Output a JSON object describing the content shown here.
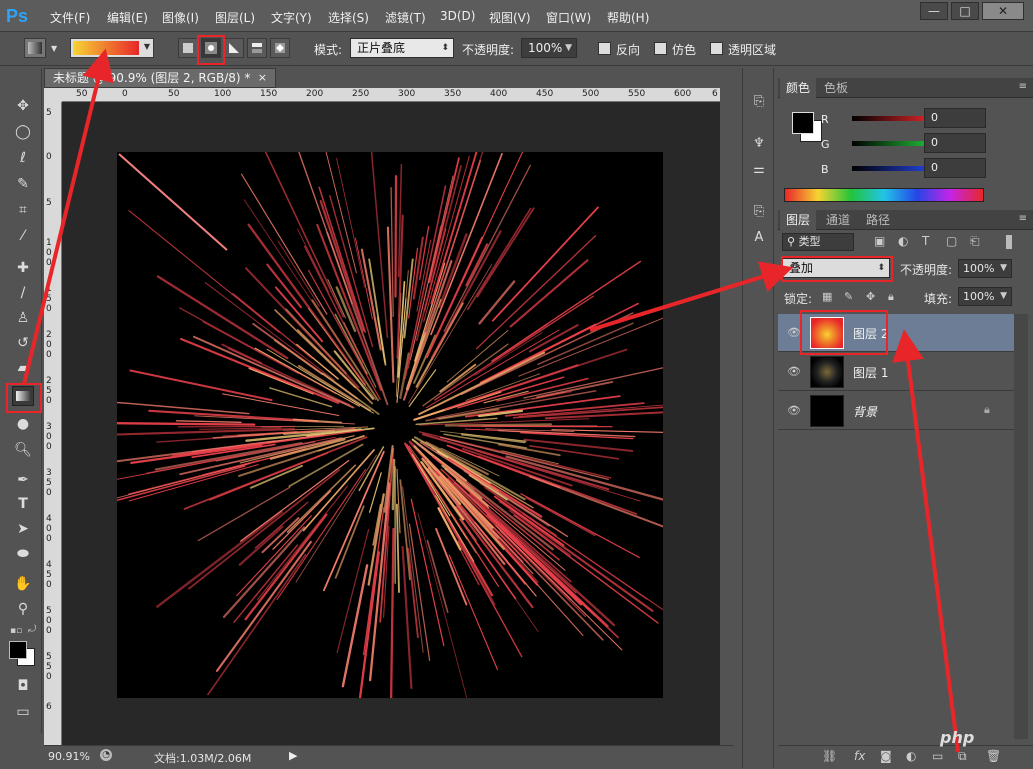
{
  "app": {
    "logo": "Ps",
    "menu": [
      "文件(F)",
      "编辑(E)",
      "图像(I)",
      "图层(L)",
      "文字(Y)",
      "选择(S)",
      "滤镜(T)",
      "3D(D)",
      "视图(V)",
      "窗口(W)",
      "帮助(H)"
    ],
    "window_buttons": {
      "minimize": "—",
      "maximize": "□",
      "close": "✕"
    }
  },
  "options": {
    "mode_label": "模式:",
    "mode_value": "正片叠底",
    "opacity_label": "不透明度:",
    "opacity_value": "100%",
    "reverse_label": "反向",
    "dither_label": "仿色",
    "transparency_label": "透明区域",
    "gradient_colors": [
      "#f7d433",
      "#e8262a"
    ]
  },
  "document": {
    "tab_title": "未标题 @ 90.9% (图层 2, RGB/8) *",
    "close_label": "×",
    "ruler_top": [
      "50",
      "0",
      "50",
      "100",
      "150",
      "200",
      "250",
      "300",
      "350",
      "400",
      "450",
      "500",
      "550",
      "600",
      "6"
    ],
    "ruler_left": [
      "5",
      "0",
      "5",
      "1 0 0",
      "1 5 0",
      "2 0 0",
      "2 5 0",
      "3 0 0",
      "3 5 0",
      "4 0 0",
      "4 5 0",
      "5 0 0",
      "5 5 0",
      "6"
    ],
    "zoom": "90.91%",
    "doc_info": "文档:1.03M/2.06M"
  },
  "color_panel": {
    "tabs": [
      "颜色",
      "色板"
    ],
    "channels": [
      {
        "label": "R",
        "value": "0",
        "color": "#e8262a"
      },
      {
        "label": "G",
        "value": "0",
        "color": "#22c43a"
      },
      {
        "label": "B",
        "value": "0",
        "color": "#2446e8"
      }
    ]
  },
  "layers_panel": {
    "tabs": [
      "图层",
      "通道",
      "路径"
    ],
    "filter_label": "类型",
    "blend_mode": "叠加",
    "opacity_label": "不透明度:",
    "opacity_value": "100%",
    "lock_label": "锁定:",
    "fill_label": "填充:",
    "fill_value": "100%",
    "layers": [
      {
        "name": "图层 2",
        "selected": true
      },
      {
        "name": "图层 1",
        "selected": false
      },
      {
        "name": "背景",
        "selected": false
      }
    ]
  },
  "watermark": "php"
}
